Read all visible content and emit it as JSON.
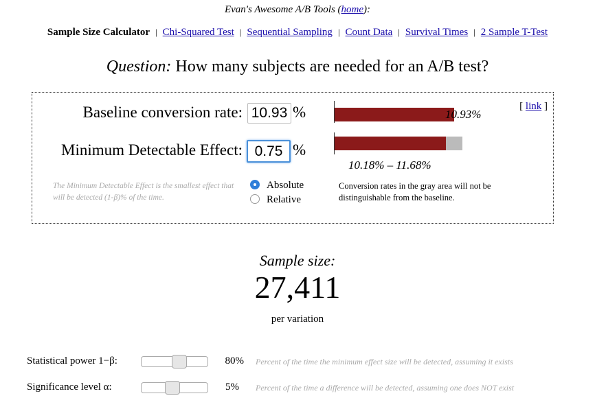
{
  "header": {
    "prefix": "Evan's Awesome A/B Tools (",
    "home_link": "home",
    "suffix": "):"
  },
  "nav": {
    "current": "Sample Size Calculator",
    "links": [
      "Chi-Squared Test",
      "Sequential Sampling",
      "Count Data",
      "Survival Times",
      "2 Sample T-Test"
    ]
  },
  "question": {
    "label": "Question:",
    "text": "How many subjects are needed for an A/B test?"
  },
  "calculator": {
    "link_text": "link",
    "baseline": {
      "label": "Baseline conversion rate:",
      "value": "10.93",
      "unit": "%"
    },
    "mde": {
      "label": "Minimum Detectable Effect:",
      "value": "0.75",
      "unit": "%"
    },
    "mde_note": "The Minimum Detectable Effect is the smallest effect that will be detected (1-β)% of the time.",
    "mode_options": [
      {
        "label": "Absolute",
        "selected": true
      },
      {
        "label": "Relative",
        "selected": false
      }
    ],
    "chart": {
      "baseline_rate": 10.93,
      "range_low": 10.18,
      "range_high": 11.68,
      "baseline_label": "10.93%",
      "range_label": "10.18% – 11.68%",
      "colors": {
        "rate": "#8b1a1a",
        "gray_area": "#bbbbbb"
      }
    },
    "explanation": "Conversion rates in the gray area will not be distinguishable from the baseline."
  },
  "result": {
    "label": "Sample size:",
    "value": "27,411",
    "per": "per variation"
  },
  "sliders": [
    {
      "label": "Statistical power 1−β:",
      "value": "80%",
      "fraction": 0.58,
      "description": "Percent of the time the minimum effect size will be detected, assuming it exists"
    },
    {
      "label": "Significance level α:",
      "value": "5%",
      "fraction": 0.45,
      "description": "Percent of the time a difference will be detected, assuming one does NOT exist"
    }
  ]
}
